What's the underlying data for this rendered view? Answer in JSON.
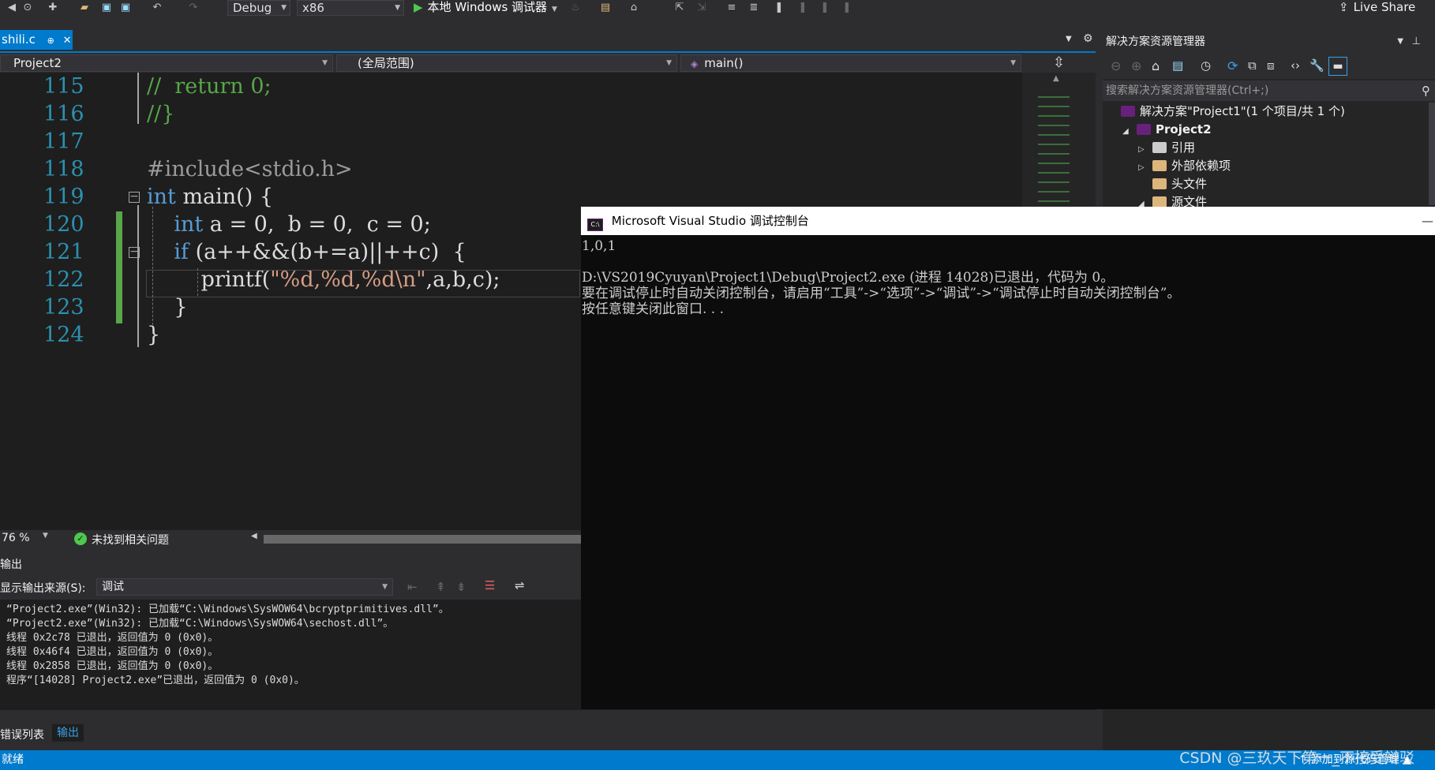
{
  "toolbar": {
    "config": "Debug",
    "platform": "x86",
    "run_label": "本地 Windows 调试器",
    "live_share": "Live Share"
  },
  "doc_tab": {
    "name": "shili.c",
    "pin": "⊕",
    "close": "✕"
  },
  "navbar": {
    "project": "Project2",
    "scope": "(全局范围)",
    "function": "main()",
    "split_glyph": "⇳"
  },
  "editor": {
    "lines": [
      {
        "num": "115",
        "parts": [
          [
            "cm",
            "//  return 0;"
          ]
        ]
      },
      {
        "num": "116",
        "parts": [
          [
            "cm",
            "//}"
          ]
        ]
      },
      {
        "num": "117",
        "parts": []
      },
      {
        "num": "118",
        "parts": [
          [
            "pp",
            "#include<stdio.h>"
          ]
        ]
      },
      {
        "num": "119",
        "parts": [
          [
            "kw",
            "int"
          ],
          [
            "",
            " main() {"
          ]
        ]
      },
      {
        "num": "120",
        "parts": [
          [
            "",
            "    "
          ],
          [
            "kw",
            "int"
          ],
          [
            "",
            " a = 0,  b = 0,  c = 0;"
          ]
        ]
      },
      {
        "num": "121",
        "parts": [
          [
            "",
            "    "
          ],
          [
            "kw",
            "if"
          ],
          [
            "",
            " (a++&&(b+=a)||++c)  {"
          ]
        ]
      },
      {
        "num": "122",
        "parts": [
          [
            "",
            "        printf("
          ],
          [
            "str",
            "\"%d,%d,%d\\n\""
          ],
          [
            "",
            ",a,b,c);"
          ]
        ]
      },
      {
        "num": "123",
        "parts": [
          [
            "",
            "    }"
          ]
        ]
      },
      {
        "num": "124",
        "parts": [
          [
            "",
            "}"
          ]
        ]
      }
    ]
  },
  "editor_status": {
    "zoom": "76 %",
    "issues": "未找到相关问题"
  },
  "output": {
    "title": "输出",
    "source_label": "显示输出来源(S):",
    "source_value": "调试",
    "lines": [
      "“Project2.exe”(Win32): 已加载“C:\\Windows\\SysWOW64\\bcryptprimitives.dll”。",
      "“Project2.exe”(Win32): 已加载“C:\\Windows\\SysWOW64\\sechost.dll”。",
      "线程 0x2c78 已退出，返回值为 0 (0x0)。",
      "线程 0x46f4 已退出，返回值为 0 (0x0)。",
      "线程 0x2858 已退出，返回值为 0 (0x0)。",
      "程序“[14028] Project2.exe”已退出，返回值为 0 (0x0)。"
    ]
  },
  "bottom_tabs": {
    "errors": "错误列表",
    "output": "输出"
  },
  "statusbar": {
    "left": "就绪",
    "right": "↑ 添加到源代码管理 ▲"
  },
  "solution_explorer": {
    "title": "解决方案资源管理器",
    "search_placeholder": "搜索解决方案资源管理器(Ctrl+;)",
    "items": [
      {
        "label": "解决方案\"Project1\"(1 个项目/共 1 个)",
        "icon": "solution-icon",
        "color": "#68217a"
      },
      {
        "label": "Project2",
        "icon": "project-icon",
        "color": "#68217a"
      },
      {
        "label": "引用",
        "icon": "references-icon",
        "color": "#cccccc"
      },
      {
        "label": "外部依赖项",
        "icon": "folder-icon",
        "color": "#dcb67a"
      },
      {
        "label": "头文件",
        "icon": "folder-icon",
        "color": "#dcb67a"
      },
      {
        "label": "源文件",
        "icon": "folder-icon",
        "color": "#dcb67a"
      }
    ]
  },
  "console": {
    "title": "Microsoft Visual Studio 调试控制台",
    "icon_text": "C:\\",
    "lines": [
      "1,0,1",
      "",
      "D:\\VS2019Cyuyan\\Project1\\Debug\\Project2.exe (进程 14028)已退出，代码为 0。",
      "要在调试停止时自动关闭控制台，请启用“工具”->“选项”->“调试”->“调试停止时自动关闭控制台”。",
      "按任意键关闭此窗口. . ."
    ]
  },
  "watermark": "CSDN @三玖天下第一_不接受辩驳"
}
